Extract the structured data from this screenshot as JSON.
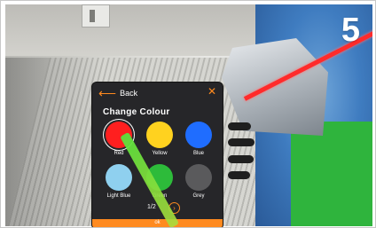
{
  "overlay": {
    "step_number": "5"
  },
  "panel": {
    "back_label": "Back",
    "close_icon": "close-icon",
    "title": "Change Colour",
    "swatches": [
      {
        "label": "Red",
        "color": "#ff1f1f",
        "selected": true
      },
      {
        "label": "Yellow",
        "color": "#ffd21f",
        "selected": false
      },
      {
        "label": "Blue",
        "color": "#1f6dff",
        "selected": false
      },
      {
        "label": "Light Blue",
        "color": "#8fd0ef",
        "selected": false
      },
      {
        "label": "Green",
        "color": "#2dbb3a",
        "selected": false
      },
      {
        "label": "Grey",
        "color": "#5a5a5c",
        "selected": false
      }
    ],
    "page_indicator": "1/2",
    "next_icon": "chevron-right-icon",
    "ok_label": "ok"
  },
  "colors": {
    "accent": "#ff8a1f",
    "panel_bg": "#262629",
    "laser_red": "#ff2b2b",
    "laser_green": "#5ae13c"
  }
}
